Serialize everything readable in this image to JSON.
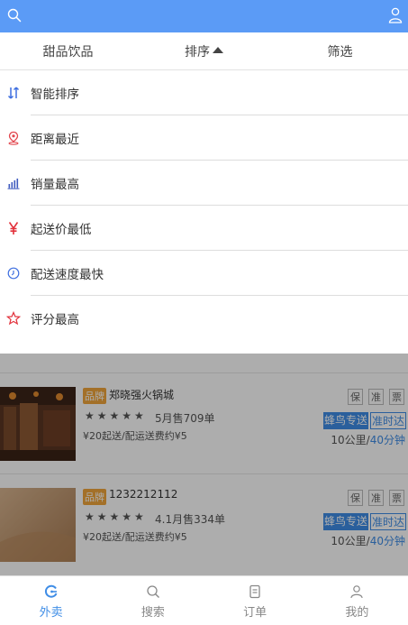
{
  "topbar": {
    "search_icon": "search-icon",
    "user_icon": "user-icon"
  },
  "tabs": [
    {
      "label": "甜品饮品"
    },
    {
      "label": "排序"
    },
    {
      "label": "筛选"
    }
  ],
  "sort_options": [
    {
      "label": "智能排序",
      "icon": "sort-arrows-icon",
      "color": "#3f6fe0"
    },
    {
      "label": "距离最近",
      "icon": "location-pin-icon",
      "color": "#e2454d"
    },
    {
      "label": "销量最高",
      "icon": "bar-chart-icon",
      "color": "#3f5bbf"
    },
    {
      "label": "起送价最低",
      "icon": "yen-icon",
      "color": "#e2303a"
    },
    {
      "label": "配送速度最快",
      "icon": "clock-icon",
      "color": "#3f6fe0"
    },
    {
      "label": "评分最高",
      "icon": "star-icon",
      "color": "#e2303a"
    }
  ],
  "shops": [
    {
      "brand_badge": "品牌",
      "name": "郑晓强火锅城",
      "stars": "★★★★★",
      "sales": "5月售709单",
      "fee": "¥20起送/配运送费约¥5",
      "tags": [
        "保",
        "准",
        "票"
      ],
      "delivery_a": "蜂鸟专送",
      "delivery_b": "准时达",
      "distance": "10公里/",
      "time": "40分钟"
    },
    {
      "brand_badge": "品牌",
      "name": "1232212112",
      "stars": "★★★★★",
      "sales": "4.1月售334单",
      "fee": "¥20起送/配运送费约¥5",
      "tags": [
        "保",
        "准",
        "票"
      ],
      "delivery_a": "蜂鸟专送",
      "delivery_b": "准时达",
      "distance": "10公里/",
      "time": "40分钟"
    }
  ],
  "bottom_nav": [
    {
      "label": "外卖",
      "icon": "takeout-icon",
      "active": true
    },
    {
      "label": "搜索",
      "icon": "search-icon"
    },
    {
      "label": "订单",
      "icon": "order-icon"
    },
    {
      "label": "我的",
      "icon": "profile-icon"
    }
  ]
}
